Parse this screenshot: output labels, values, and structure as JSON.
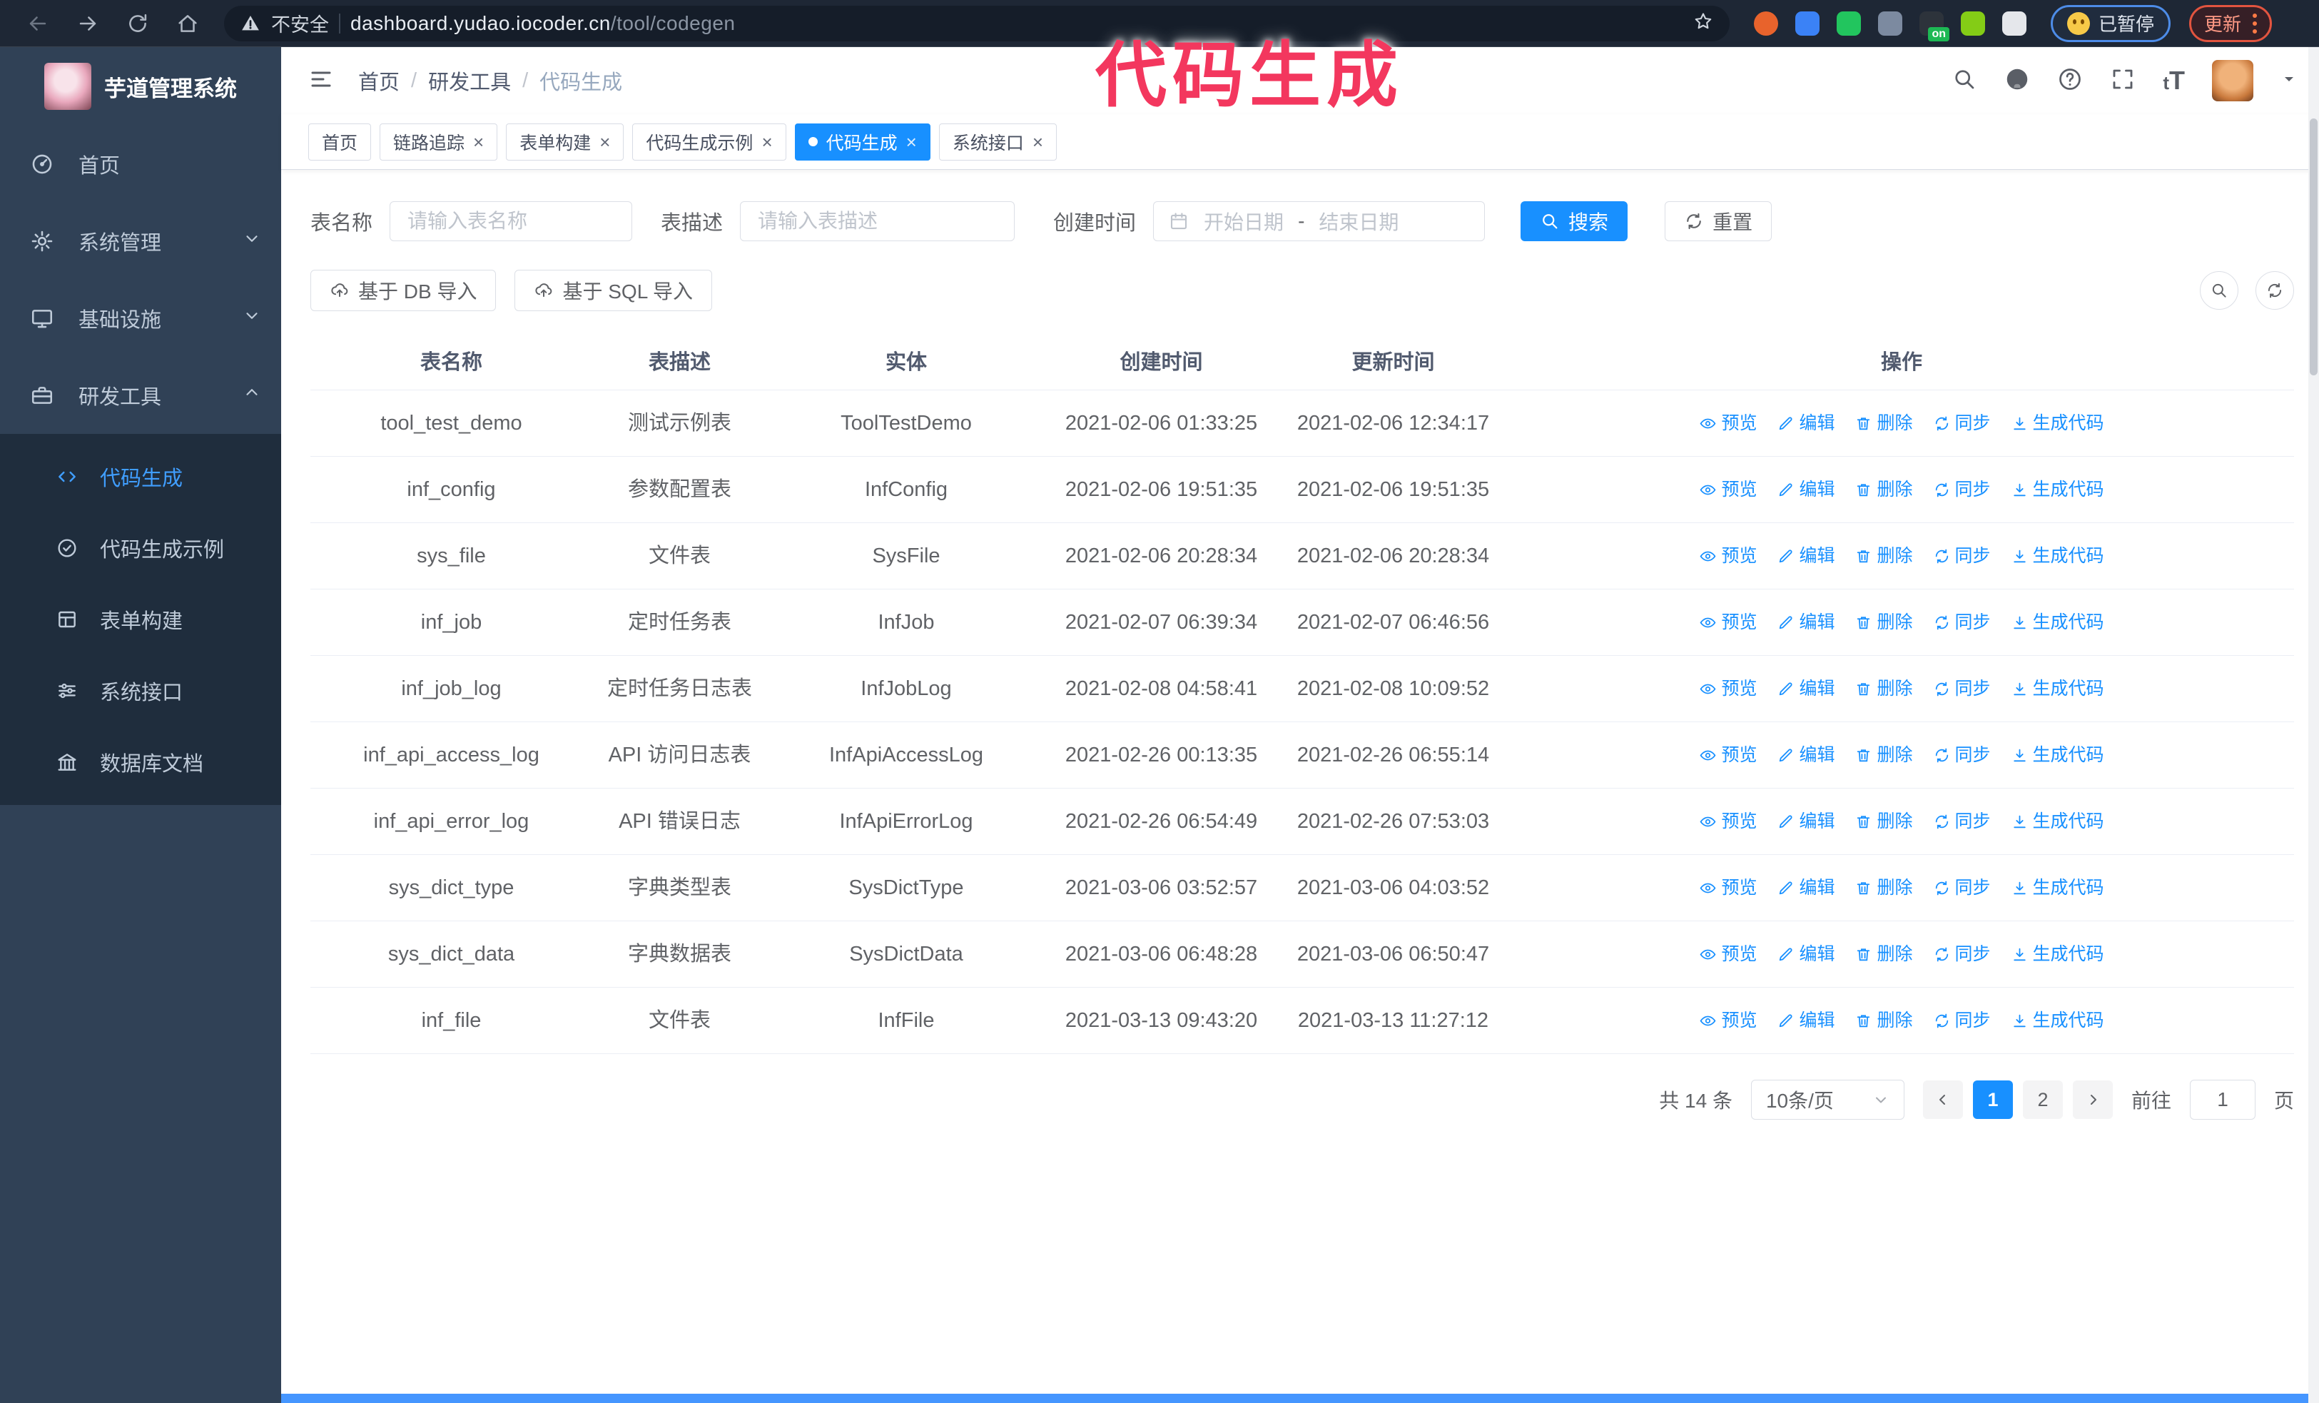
{
  "colors": {
    "accent": "#1890ff",
    "sidebar_bg": "#304156",
    "submenu_bg": "#1f2d3d",
    "chrome_bg": "#1e2735",
    "overlay_pink": "#f3375e",
    "update_red": "#e2543f",
    "paused_blue": "#4d8ce8"
  },
  "overlay_title": "代码生成",
  "browser": {
    "security_label": "不安全",
    "url_host": "dashboard.yudao.iocoder.cn",
    "url_path": "/tool/codegen",
    "paused_badge": "已暂停",
    "update_label": "更新",
    "extensions": [
      {
        "name": "ext-orange-ring",
        "color": "#e8632c"
      },
      {
        "name": "ext-blue-gem",
        "color": "#3b82f6"
      },
      {
        "name": "ext-green-check",
        "color": "#22c55e"
      },
      {
        "name": "ext-grid-drop",
        "color": "#7c8aa0"
      },
      {
        "name": "ext-dark-on",
        "color": "#2d333b",
        "label": "on"
      },
      {
        "name": "ext-green-bug",
        "color": "#84cc16"
      },
      {
        "name": "ext-puzzle",
        "color": "#e5e7eb"
      }
    ]
  },
  "sidebar": {
    "app_title": "芋道管理系统",
    "items": [
      {
        "label": "首页",
        "icon": "dashboard-icon"
      },
      {
        "label": "系统管理",
        "icon": "gear-icon",
        "expand": "down"
      },
      {
        "label": "基础设施",
        "icon": "monitor-icon",
        "expand": "down"
      },
      {
        "label": "研发工具",
        "icon": "toolbox-icon",
        "expand": "up"
      }
    ],
    "sub_items": [
      {
        "label": "代码生成",
        "icon": "code-icon",
        "active": true
      },
      {
        "label": "代码生成示例",
        "icon": "badge-check-icon"
      },
      {
        "label": "表单构建",
        "icon": "form-icon"
      },
      {
        "label": "系统接口",
        "icon": "sliders-icon"
      },
      {
        "label": "数据库文档",
        "icon": "columns-icon"
      }
    ]
  },
  "topbar": {
    "breadcrumb": [
      "首页",
      "研发工具",
      "代码生成"
    ],
    "separator": "/"
  },
  "tabbar": {
    "tabs": [
      {
        "label": "首页",
        "closable": false,
        "active": false
      },
      {
        "label": "链路追踪",
        "closable": true,
        "active": false
      },
      {
        "label": "表单构建",
        "closable": true,
        "active": false
      },
      {
        "label": "代码生成示例",
        "closable": true,
        "active": false
      },
      {
        "label": "代码生成",
        "closable": true,
        "active": true
      },
      {
        "label": "系统接口",
        "closable": true,
        "active": false
      }
    ],
    "close_glyph": "×"
  },
  "filters": {
    "table_name_label": "表名称",
    "table_name_placeholder": "请输入表名称",
    "table_desc_label": "表描述",
    "table_desc_placeholder": "请输入表描述",
    "create_time_label": "创建时间",
    "date_start_placeholder": "开始日期",
    "date_separator": "-",
    "date_end_placeholder": "结束日期",
    "search_label": "搜索",
    "reset_label": "重置"
  },
  "toolbar": {
    "import_db_label": "基于 DB 导入",
    "import_sql_label": "基于 SQL 导入"
  },
  "table": {
    "columns": [
      "表名称",
      "表描述",
      "实体",
      "创建时间",
      "更新时间",
      "操作"
    ],
    "actions": [
      {
        "label": "预览",
        "icon": "eye-icon"
      },
      {
        "label": "编辑",
        "icon": "edit-icon"
      },
      {
        "label": "删除",
        "icon": "delete-icon"
      },
      {
        "label": "同步",
        "icon": "sync-icon"
      },
      {
        "label": "生成代码",
        "icon": "download-icon"
      }
    ],
    "rows": [
      {
        "name": "tool_test_demo",
        "desc": "测试示例表",
        "entity": "ToolTestDemo",
        "created": "2021-02-06 01:33:25",
        "updated": "2021-02-06 12:34:17"
      },
      {
        "name": "inf_config",
        "desc": "参数配置表",
        "entity": "InfConfig",
        "created": "2021-02-06 19:51:35",
        "updated": "2021-02-06 19:51:35"
      },
      {
        "name": "sys_file",
        "desc": "文件表",
        "entity": "SysFile",
        "created": "2021-02-06 20:28:34",
        "updated": "2021-02-06 20:28:34"
      },
      {
        "name": "inf_job",
        "desc": "定时任务表",
        "entity": "InfJob",
        "created": "2021-02-07 06:39:34",
        "updated": "2021-02-07 06:46:56"
      },
      {
        "name": "inf_job_log",
        "desc": "定时任务日志表",
        "entity": "InfJobLog",
        "created": "2021-02-08 04:58:41",
        "updated": "2021-02-08 10:09:52"
      },
      {
        "name": "inf_api_access_log",
        "desc": "API 访问日志表",
        "entity": "InfApiAccessLog",
        "created": "2021-02-26 00:13:35",
        "updated": "2021-02-26 06:55:14"
      },
      {
        "name": "inf_api_error_log",
        "desc": "API 错误日志",
        "entity": "InfApiErrorLog",
        "created": "2021-02-26 06:54:49",
        "updated": "2021-02-26 07:53:03"
      },
      {
        "name": "sys_dict_type",
        "desc": "字典类型表",
        "entity": "SysDictType",
        "created": "2021-03-06 03:52:57",
        "updated": "2021-03-06 04:03:52"
      },
      {
        "name": "sys_dict_data",
        "desc": "字典数据表",
        "entity": "SysDictData",
        "created": "2021-03-06 06:48:28",
        "updated": "2021-03-06 06:50:47"
      },
      {
        "name": "inf_file",
        "desc": "文件表",
        "entity": "InfFile",
        "created": "2021-03-13 09:43:20",
        "updated": "2021-03-13 11:27:12"
      }
    ]
  },
  "pagination": {
    "total_label": "共 14 条",
    "page_size_label": "10条/页",
    "pages": [
      "1",
      "2"
    ],
    "active_page": "1",
    "goto_label": "前往",
    "goto_value": "1",
    "page_unit": "页"
  }
}
